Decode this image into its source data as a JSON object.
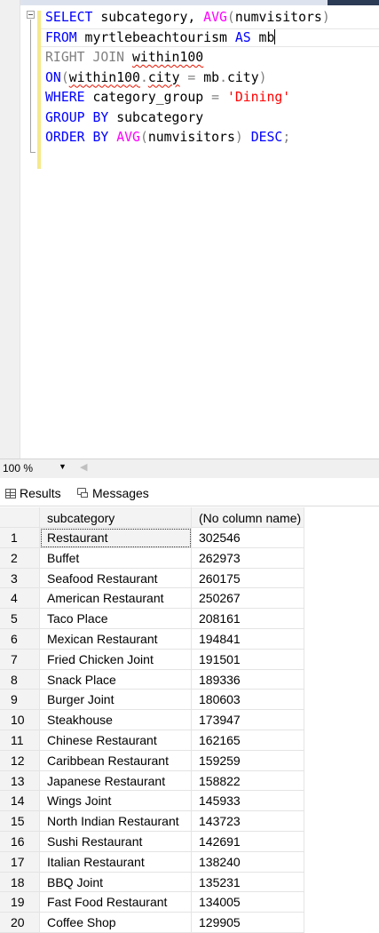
{
  "editor": {
    "lines": [
      [
        {
          "t": "SELECT",
          "c": "kw"
        },
        {
          "t": " subcategory, "
        },
        {
          "t": "AVG",
          "c": "fn"
        },
        {
          "t": "(",
          "c": "gr"
        },
        {
          "t": "numvisitors"
        },
        {
          "t": ")",
          "c": "gr"
        }
      ],
      [
        {
          "t": "FROM",
          "c": "kw"
        },
        {
          "t": " myrtlebeachtourism "
        },
        {
          "t": "AS",
          "c": "kw"
        },
        {
          "t": " mb"
        },
        {
          "t": "",
          "c": "caret"
        }
      ],
      [
        {
          "t": "RIGHT JOIN",
          "c": "gr"
        },
        {
          "t": " "
        },
        {
          "t": "within100",
          "c": "squig"
        }
      ],
      [
        {
          "t": "ON",
          "c": "kw"
        },
        {
          "t": "(",
          "c": "gr"
        },
        {
          "t": "within100",
          "c": "squig"
        },
        {
          "t": ".",
          "c": "gr"
        },
        {
          "t": "city",
          "c": "squig"
        },
        {
          "t": " = ",
          "c": "gr"
        },
        {
          "t": "mb"
        },
        {
          "t": ".",
          "c": "gr"
        },
        {
          "t": "city"
        },
        {
          "t": ")",
          "c": "gr"
        }
      ],
      [
        {
          "t": "WHERE",
          "c": "kw"
        },
        {
          "t": " category_group "
        },
        {
          "t": "=",
          "c": "gr"
        },
        {
          "t": " "
        },
        {
          "t": "'Dining'",
          "c": "str"
        }
      ],
      [
        {
          "t": "GROUP BY",
          "c": "kw"
        },
        {
          "t": " subcategory"
        }
      ],
      [
        {
          "t": "ORDER BY",
          "c": "kw"
        },
        {
          "t": " "
        },
        {
          "t": "AVG",
          "c": "fn"
        },
        {
          "t": "(",
          "c": "gr"
        },
        {
          "t": "numvisitors"
        },
        {
          "t": ")",
          "c": "gr"
        },
        {
          "t": " "
        },
        {
          "t": "DESC",
          "c": "kw"
        },
        {
          "t": ";",
          "c": "gr"
        }
      ]
    ]
  },
  "zoom": {
    "value": "100 %",
    "dropdown": "▼",
    "scroll_left": "◀"
  },
  "tabs": {
    "results": "Results",
    "messages": "Messages"
  },
  "grid": {
    "headers": [
      "subcategory",
      "(No column name)"
    ],
    "rows": [
      [
        "1",
        "Restaurant",
        "302546"
      ],
      [
        "2",
        "Buffet",
        "262973"
      ],
      [
        "3",
        "Seafood Restaurant",
        "260175"
      ],
      [
        "4",
        "American Restaurant",
        "250267"
      ],
      [
        "5",
        "Taco Place",
        "208161"
      ],
      [
        "6",
        "Mexican Restaurant",
        "194841"
      ],
      [
        "7",
        "Fried Chicken Joint",
        "191501"
      ],
      [
        "8",
        "Snack Place",
        "189336"
      ],
      [
        "9",
        "Burger Joint",
        "180603"
      ],
      [
        "10",
        "Steakhouse",
        "173947"
      ],
      [
        "11",
        "Chinese Restaurant",
        "162165"
      ],
      [
        "12",
        "Caribbean Restaurant",
        "159259"
      ],
      [
        "13",
        "Japanese Restaurant",
        "158822"
      ],
      [
        "14",
        "Wings Joint",
        "145933"
      ],
      [
        "15",
        "North Indian Restaurant",
        "143723"
      ],
      [
        "16",
        "Sushi Restaurant",
        "142691"
      ],
      [
        "17",
        "Italian Restaurant",
        "138240"
      ],
      [
        "18",
        "BBQ Joint",
        "135231"
      ],
      [
        "19",
        "Fast Food Restaurant",
        "134005"
      ],
      [
        "20",
        "Coffee Shop",
        "129905"
      ]
    ]
  }
}
